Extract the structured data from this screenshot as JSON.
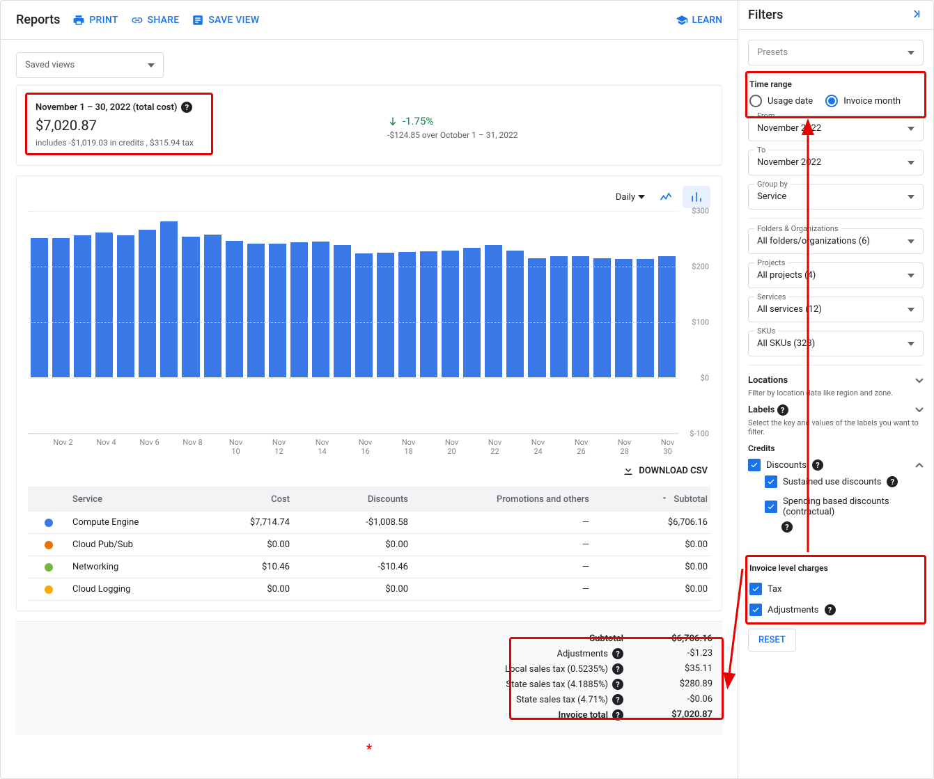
{
  "header": {
    "title": "Reports",
    "print": "PRINT",
    "share": "SHARE",
    "save_view": "SAVE VIEW",
    "learn": "LEARN"
  },
  "saved_views_label": "Saved views",
  "summary": {
    "title": "November 1 – 30, 2022 (total cost)",
    "amount": "$7,020.87",
    "sub": "includes -$1,019.03 in credits , $315.94 tax",
    "delta_pct": "-1.75%",
    "delta_line": "-$124.85 over October 1 – 31, 2022"
  },
  "chart_toolbar": {
    "granularity": "Daily"
  },
  "chart_data": {
    "type": "bar",
    "categories": [
      "Nov 1",
      "Nov 2",
      "Nov 3",
      "Nov 4",
      "Nov 5",
      "Nov 6",
      "Nov 7",
      "Nov 8",
      "Nov 9",
      "Nov 10",
      "Nov 11",
      "Nov 12",
      "Nov 13",
      "Nov 14",
      "Nov 15",
      "Nov 16",
      "Nov 17",
      "Nov 18",
      "Nov 19",
      "Nov 20",
      "Nov 21",
      "Nov 22",
      "Nov 23",
      "Nov 24",
      "Nov 25",
      "Nov 26",
      "Nov 27",
      "Nov 28",
      "Nov 29",
      "Nov 30"
    ],
    "values": [
      250,
      250,
      255,
      260,
      255,
      265,
      280,
      252,
      256,
      245,
      240,
      240,
      242,
      244,
      238,
      222,
      224,
      225,
      226,
      228,
      232,
      238,
      228,
      214,
      218,
      218,
      214,
      212,
      212,
      218
    ],
    "ylim": [
      -100,
      300
    ],
    "yticks": [
      "$300",
      "$200",
      "$100",
      "$0",
      "$-100"
    ],
    "xticks_shown": [
      "Nov 2",
      "Nov 4",
      "Nov 6",
      "Nov 8",
      "Nov 10",
      "Nov 12",
      "Nov 14",
      "Nov 16",
      "Nov 18",
      "Nov 20",
      "Nov 22",
      "Nov 24",
      "Nov 26",
      "Nov 28",
      "Nov 30"
    ]
  },
  "download_csv": "DOWNLOAD CSV",
  "table": {
    "columns": {
      "service": "Service",
      "cost": "Cost",
      "discounts": "Discounts",
      "promo": "Promotions and others",
      "subtotal": "Subtotal"
    },
    "rows": [
      {
        "color": "#3b78e7",
        "service": "Compute Engine",
        "cost": "$7,714.74",
        "discounts": "-$1,008.58",
        "promo": "—",
        "subtotal": "$6,706.16"
      },
      {
        "color": "#e8710a",
        "service": "Cloud Pub/Sub",
        "cost": "$0.00",
        "discounts": "$0.00",
        "promo": "—",
        "subtotal": "$0.00"
      },
      {
        "color": "#7cb342",
        "service": "Networking",
        "cost": "$10.46",
        "discounts": "-$10.46",
        "promo": "—",
        "subtotal": "$0.00"
      },
      {
        "color": "#f9ab00",
        "service": "Cloud Logging",
        "cost": "$0.00",
        "discounts": "$0.00",
        "promo": "—",
        "subtotal": "$0.00"
      }
    ]
  },
  "totals": {
    "subtotal_label": "Subtotal",
    "subtotal": "$6,706.16",
    "adj_label": "Adjustments",
    "adj": "-$1.23",
    "local_tax_label": "Local sales tax (0.5235%)",
    "local_tax": "$35.11",
    "state_tax1_label": "State sales tax (4.1885%)",
    "state_tax1": "$280.89",
    "state_tax2_label": "State sales tax (4.71%)",
    "state_tax2": "-$0.06",
    "invoice_label": "Invoice total",
    "invoice": "$7,020.87"
  },
  "filters": {
    "title": "Filters",
    "presets": "Presets",
    "time_range_title": "Time range",
    "usage_date": "Usage date",
    "invoice_month": "Invoice month",
    "from_label": "From",
    "from_value": "November 2022",
    "to_label": "To",
    "to_value": "November 2022",
    "group_by_label": "Group by",
    "group_by_value": "Service",
    "folders_label": "Folders & Organizations",
    "folders_value": "All folders/organizations (6)",
    "projects_label": "Projects",
    "projects_value": "All projects (4)",
    "services_label": "Services",
    "services_value": "All services (12)",
    "skus_label": "SKUs",
    "skus_value": "All SKUs (323)",
    "locations_title": "Locations",
    "locations_sub": "Filter by location data like region and zone.",
    "labels_title": "Labels",
    "labels_sub": "Select the key and values of the labels you want to filter.",
    "credits_title": "Credits",
    "cred_discounts": "Discounts",
    "cred_sustained": "Sustained use discounts",
    "cred_spending": "Spending based discounts (contractual)",
    "invoice_level_title": "Invoice level charges",
    "tax": "Tax",
    "adjustments": "Adjustments",
    "reset": "RESET"
  }
}
